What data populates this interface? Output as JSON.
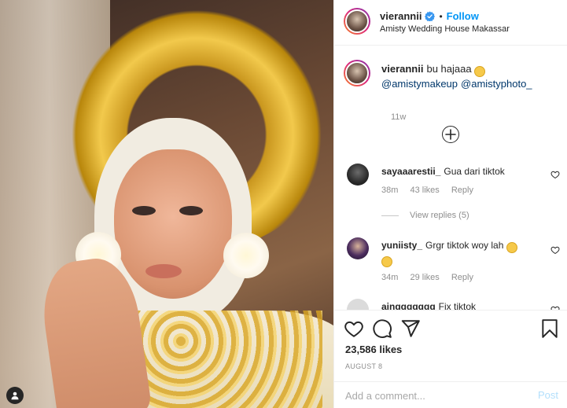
{
  "post_image": {
    "tag_icon": "user-tag-icon"
  },
  "header": {
    "username": "vierannii",
    "verified_icon": "verified-badge-icon",
    "separator": "•",
    "follow_label": "Follow",
    "location": "Amisty Wedding House Makassar"
  },
  "caption": {
    "username": "vierannii",
    "text": "bu hajaaa",
    "emoji": "grinning-face-emoji",
    "mentions": [
      "@amistymakeup",
      "@amistyphoto_"
    ],
    "time": "11w"
  },
  "load_more_icon": "plus-circle-icon",
  "comments": [
    {
      "username": "sayaaarestii_",
      "text": "Gua dari tiktok",
      "time": "38m",
      "likes": "43 likes",
      "reply": "Reply",
      "view_replies": "View replies (5)"
    },
    {
      "username": "yuniisty_",
      "text": "Grgr tiktok woy lah",
      "emoji": "crying-face-emoji",
      "time": "34m",
      "likes": "29 likes",
      "reply": "Reply"
    },
    {
      "username": "ajnggggggg",
      "text": "Fix tiktok"
    }
  ],
  "actions": {
    "like_icon": "heart-icon",
    "comment_icon": "comment-icon",
    "share_icon": "paper-plane-icon",
    "save_icon": "bookmark-icon",
    "likes": "23,586 likes",
    "date": "AUGUST 8"
  },
  "add_comment": {
    "placeholder": "Add a comment...",
    "post_label": "Post"
  },
  "colors": {
    "accent": "#0095f6",
    "post_disabled": "#b2dffc",
    "muted": "#8e8e8e"
  }
}
